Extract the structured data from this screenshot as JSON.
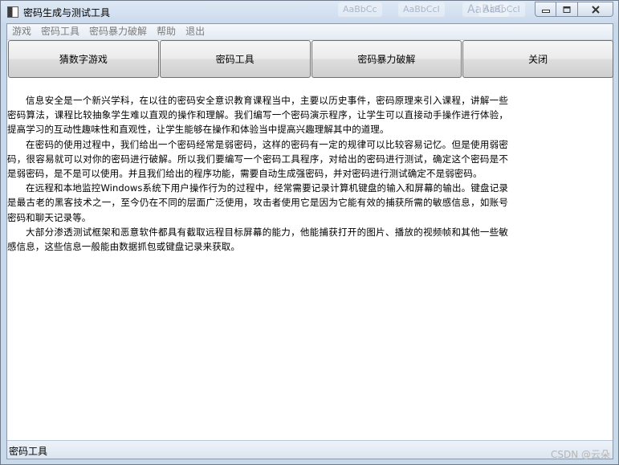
{
  "window": {
    "title": "密码生成与测试工具",
    "background_ghost_texts": [
      "AaBbCc",
      "AaBbCcI",
      "AaBbC",
      "AaBbCcI"
    ]
  },
  "menu": {
    "items": [
      {
        "label": "游戏"
      },
      {
        "label": "密码工具"
      },
      {
        "label": "密码暴力破解"
      },
      {
        "label": "帮助"
      },
      {
        "label": "退出"
      }
    ]
  },
  "toolbar": {
    "buttons": [
      {
        "label": "猜数字游戏"
      },
      {
        "label": "密码工具"
      },
      {
        "label": "密码暴力破解"
      },
      {
        "label": "关闭"
      }
    ]
  },
  "content": {
    "paragraphs": [
      "信息安全是一个新兴学科，在以往的密码安全意识教育课程当中，主要以历史事件，密码原理来引入课程，讲解一些密码算法，课程比较抽象学生难以直观的操作和理解。我们编写一个密码演示程序，让学生可以直接动手操作进行体验，提高学习的互动性趣味性和直观性，让学生能够在操作和体验当中提高兴趣理解其中的道理。",
      "在密码的使用过程中，我们给出一个密码经常是弱密码，这样的密码有一定的规律可以比较容易记忆。但是使用弱密码，很容易就可以对你的密码进行破解。所以我们要编写一个密码工具程序，对给出的密码进行测试，确定这个密码是不是弱密码，是不是可以使用。并且我们给出的程序功能，需要自动生成强密码，并对密码进行测试确定不是弱密码。",
      "在远程和本地监控Windows系统下用户操作行为的过程中，经常需要记录计算机键盘的输入和屏幕的输出。键盘记录是最古老的黑客技术之一，至今仍在不同的层面广泛使用，攻击者使用它是因为它能有效的捕获所需的敏感信息，如账号密码和聊天记录等。",
      "大部分渗透测试框架和恶意软件都具有截取远程目标屏幕的能力，他能捕获打开的图片、播放的视频帧和其他一些敏感信息，这些信息一般能由数据抓包或键盘记录来获取。"
    ]
  },
  "statusbar": {
    "text": "密码工具"
  },
  "watermark": {
    "text": "CSDN @云朵"
  },
  "icons": {
    "app": "app-window-icon",
    "minimize": "minimize-icon",
    "maximize": "maximize-icon",
    "close": "close-icon"
  }
}
